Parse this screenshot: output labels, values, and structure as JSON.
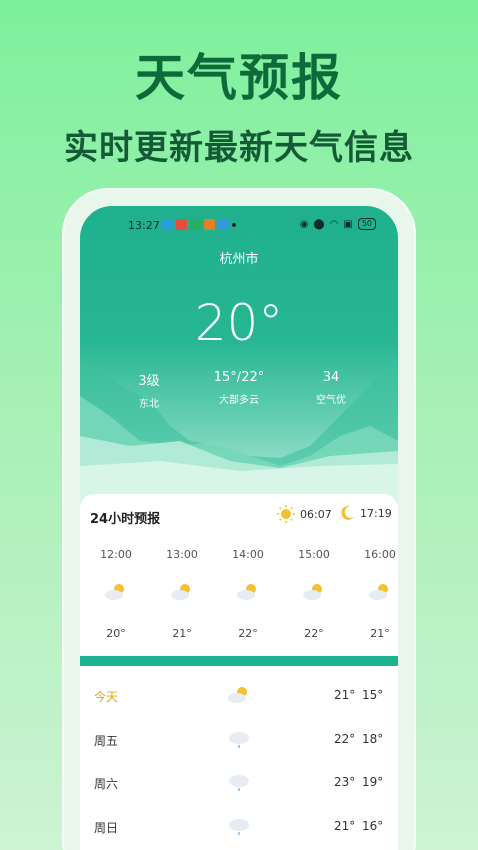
{
  "promo": {
    "title": "天气预报",
    "subtitle": "实时更新最新天气信息"
  },
  "status_bar": {
    "time": "13:27",
    "battery": "50"
  },
  "weather": {
    "city": "杭州市",
    "temperature": "20°",
    "wind": {
      "value": "3级",
      "label": "东北"
    },
    "range": {
      "value": "15°/22°",
      "label": "大部多云"
    },
    "aqi": {
      "value": "34",
      "label": "空气优"
    }
  },
  "hourly": {
    "title": "24小时预报",
    "sunrise": "06:07",
    "sunset": "17:19",
    "items": [
      {
        "time": "12:00",
        "temp": "20°",
        "icon": "partly-cloudy-icon"
      },
      {
        "time": "13:00",
        "temp": "21°",
        "icon": "partly-cloudy-icon"
      },
      {
        "time": "14:00",
        "temp": "22°",
        "icon": "partly-cloudy-icon"
      },
      {
        "time": "15:00",
        "temp": "22°",
        "icon": "partly-cloudy-icon"
      },
      {
        "time": "16:00",
        "temp": "21°",
        "icon": "partly-cloudy-icon"
      }
    ]
  },
  "daily": [
    {
      "day": "今天",
      "hi": "21°",
      "lo": "15°",
      "icon": "partly-cloudy-icon"
    },
    {
      "day": "周五",
      "hi": "22°",
      "lo": "18°",
      "icon": "light-rain-icon"
    },
    {
      "day": "周六",
      "hi": "23°",
      "lo": "19°",
      "icon": "light-rain-icon"
    },
    {
      "day": "周日",
      "hi": "21°",
      "lo": "16°",
      "icon": "light-rain-icon"
    }
  ],
  "colors": {
    "accent": "#1db38f",
    "today": "#e8a31c",
    "promo_text": "#0f6a3a"
  }
}
